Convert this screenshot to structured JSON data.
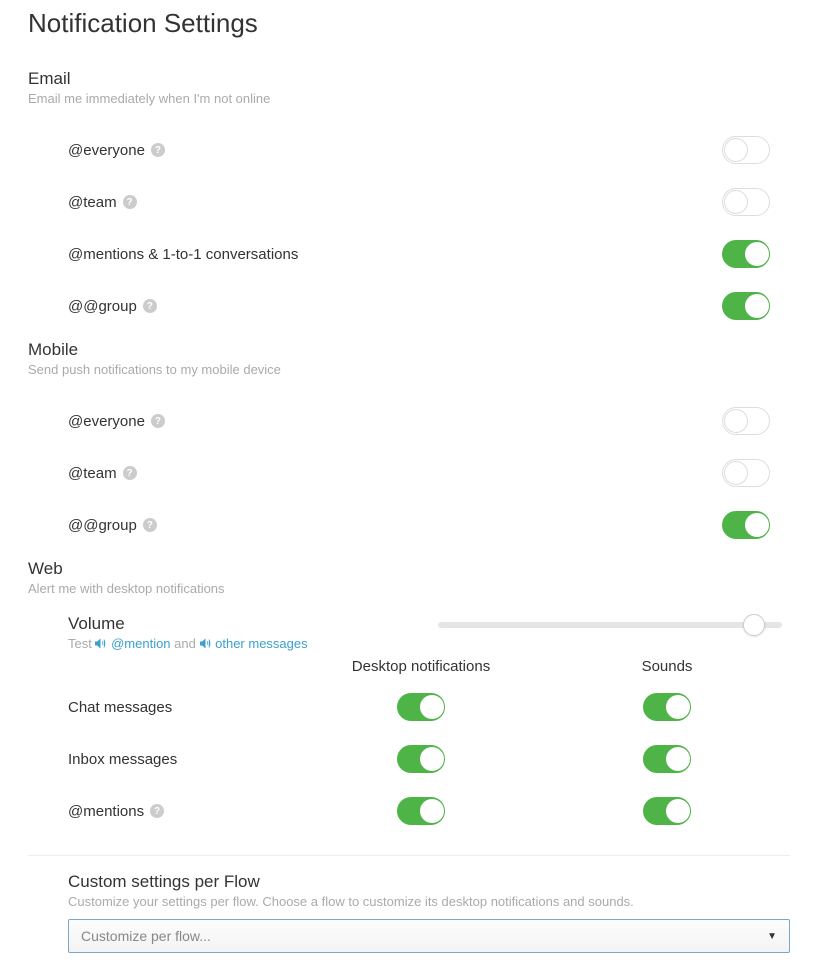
{
  "page_title": "Notification Settings",
  "email": {
    "title": "Email",
    "desc": "Email me immediately when I'm not online",
    "items": [
      {
        "label": "@everyone",
        "help": true,
        "on": false
      },
      {
        "label": "@team",
        "help": true,
        "on": false
      },
      {
        "label": "@mentions & 1-to-1 conversations",
        "help": false,
        "on": true
      },
      {
        "label": "@@group",
        "help": true,
        "on": true
      }
    ]
  },
  "mobile": {
    "title": "Mobile",
    "desc": "Send push notifications to my mobile device",
    "items": [
      {
        "label": "@everyone",
        "help": true,
        "on": false
      },
      {
        "label": "@team",
        "help": true,
        "on": false
      },
      {
        "label": "@@group",
        "help": true,
        "on": true
      }
    ]
  },
  "web": {
    "title": "Web",
    "desc": "Alert me with desktop notifications",
    "volume": {
      "title": "Volume",
      "test_prefix": "Test",
      "mention_link": "@mention",
      "and_text": "and",
      "other_link": "other messages",
      "value_pct": 92
    },
    "headers": {
      "desktop": "Desktop notifications",
      "sounds": "Sounds"
    },
    "items": [
      {
        "label": "Chat messages",
        "help": false,
        "desktop_on": true,
        "sounds_on": true
      },
      {
        "label": "Inbox messages",
        "help": false,
        "desktop_on": true,
        "sounds_on": true
      },
      {
        "label": "@mentions",
        "help": true,
        "desktop_on": true,
        "sounds_on": true
      }
    ],
    "custom": {
      "title": "Custom settings per Flow",
      "desc": "Customize your settings per flow. Choose a flow to customize its desktop notifications and sounds.",
      "select_placeholder": "Customize per flow..."
    }
  }
}
